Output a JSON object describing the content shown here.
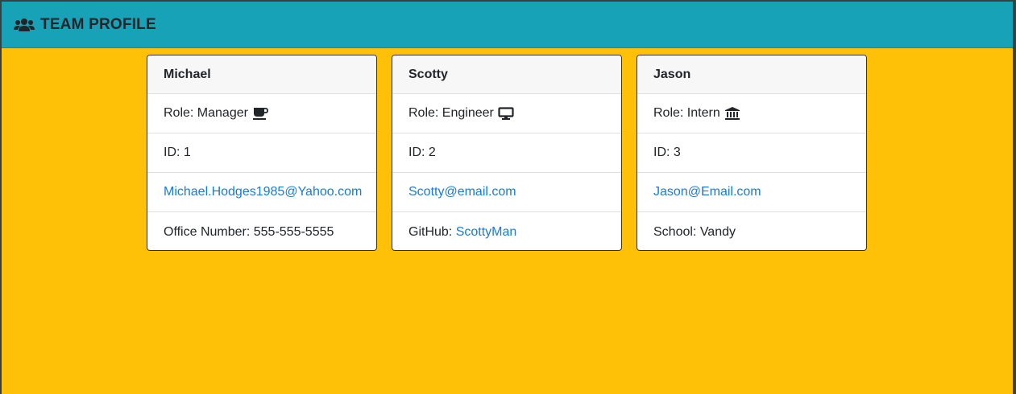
{
  "header": {
    "title": "TEAM PROFILE",
    "icon": "users-icon",
    "background_color": "#17a2b8"
  },
  "page": {
    "background_color": "#ffc107",
    "link_color": "#1a7ad6"
  },
  "cards": [
    {
      "name": "Michael",
      "role": "Role: Manager",
      "role_icon": "coffee-icon",
      "id": "ID: 1",
      "email": "Michael.Hodges1985@Yahoo.com",
      "extra_label": "Office Number: 555-555-5555",
      "extra_link": ""
    },
    {
      "name": "Scotty",
      "role": "Role: Engineer",
      "role_icon": "desktop-icon",
      "id": "ID: 2",
      "email": "Scotty@email.com",
      "extra_label": "GitHub: ",
      "extra_link": "ScottyMan"
    },
    {
      "name": "Jason",
      "role": "Role: Intern",
      "role_icon": "university-icon",
      "id": "ID: 3",
      "email": "Jason@Email.com",
      "extra_label": "School: Vandy",
      "extra_link": ""
    }
  ]
}
